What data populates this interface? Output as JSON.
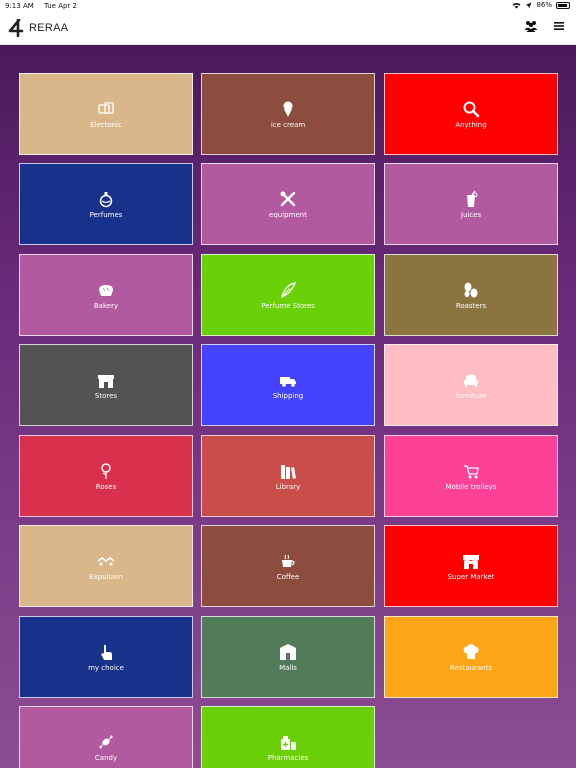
{
  "status_bar": {
    "time": "9:13 AM",
    "date": "Tue Apr 2",
    "battery": "86%"
  },
  "header": {
    "app_name": "RERAA"
  },
  "categories": [
    {
      "label": "Electonic",
      "color": "#d9b78b",
      "icon": "electronics-icon"
    },
    {
      "label": "ice cream",
      "color": "#8c4c3e",
      "icon": "ice-cream-icon"
    },
    {
      "label": "Anything",
      "color": "#fe0000",
      "icon": "search-icon"
    },
    {
      "label": "Perfumes",
      "color": "#18318b",
      "icon": "perfume-bottle-icon"
    },
    {
      "label": "equipment",
      "color": "#b25a9f",
      "icon": "tools-icon"
    },
    {
      "label": "Juices",
      "color": "#b25a9f",
      "icon": "juice-icon"
    },
    {
      "label": "Bakery",
      "color": "#b25a9f",
      "icon": "bread-icon"
    },
    {
      "label": "Perfume Stores",
      "color": "#6ad008",
      "icon": "feather-icon"
    },
    {
      "label": "Roasters",
      "color": "#8c7440",
      "icon": "coffee-beans-icon"
    },
    {
      "label": "Stores",
      "color": "#535353",
      "icon": "store-icon"
    },
    {
      "label": "Shipping",
      "color": "#4443fb",
      "icon": "truck-icon"
    },
    {
      "label": "furniture",
      "color": "#febcc3",
      "icon": "armchair-icon"
    },
    {
      "label": "Roses",
      "color": "#d9304d",
      "icon": "rose-icon"
    },
    {
      "label": "Library",
      "color": "#c94e4a",
      "icon": "books-icon"
    },
    {
      "label": "Mobile trolleys",
      "color": "#fd4196",
      "icon": "food-cart-icon"
    },
    {
      "label": "Expulsion",
      "color": "#d9b78b",
      "icon": "moving-icon"
    },
    {
      "label": "Coffee",
      "color": "#8c4c3e",
      "icon": "coffee-cup-icon"
    },
    {
      "label": "Super Market",
      "color": "#fe0000",
      "icon": "shop-icon"
    },
    {
      "label": "my choice",
      "color": "#18318b",
      "icon": "hand-pointer-icon"
    },
    {
      "label": "Malls",
      "color": "#527c59",
      "icon": "mall-icon"
    },
    {
      "label": "Restaurants",
      "color": "#fda417",
      "icon": "chef-hat-icon"
    },
    {
      "label": "Candy",
      "color": "#b25a9f",
      "icon": "candy-icon"
    },
    {
      "label": "Pharmacies",
      "color": "#6ad008",
      "icon": "pharmacy-icon"
    }
  ]
}
